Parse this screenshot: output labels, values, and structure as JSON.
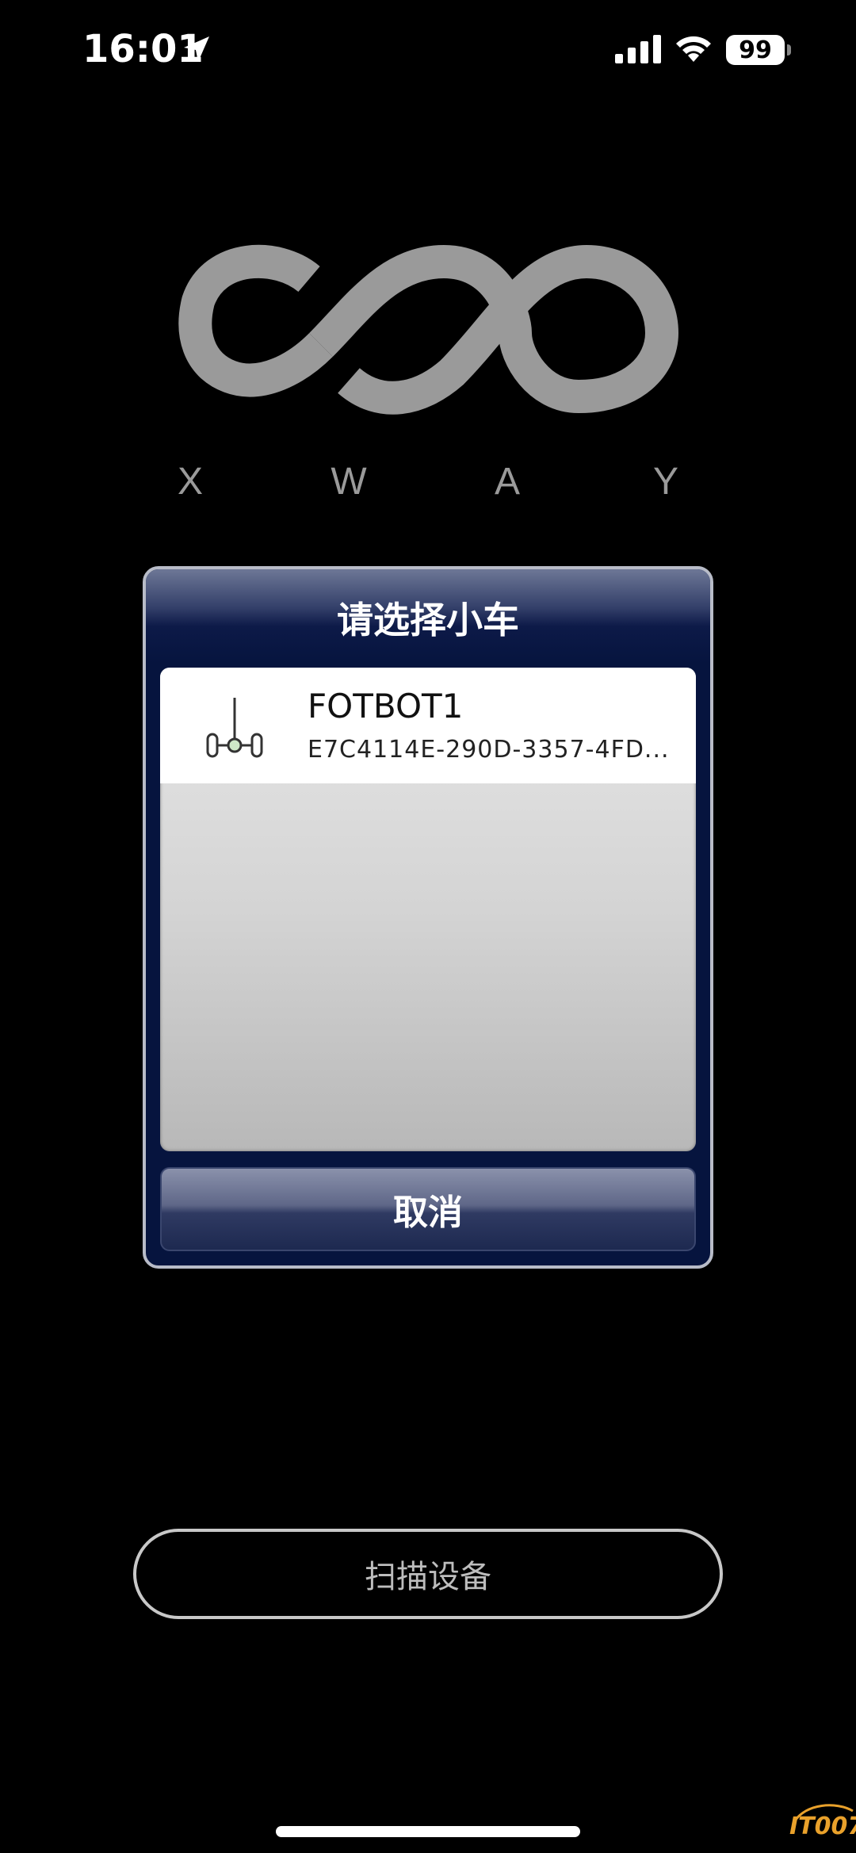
{
  "status_bar": {
    "time": "16:01",
    "battery": "99",
    "icons": [
      "location-arrow-icon",
      "cellular-signal-icon",
      "wifi-icon",
      "battery-icon"
    ]
  },
  "logo": {
    "letters": [
      "X",
      "W",
      "A",
      "Y"
    ]
  },
  "dialog": {
    "title": "请选择小车",
    "devices": [
      {
        "name": "FOTBOT1",
        "uuid": "E7C4114E-290D-3357-4FD...",
        "icon": "robot-car-icon"
      }
    ],
    "cancel_label": "取消"
  },
  "scan_button": {
    "label": "扫描设备"
  },
  "watermark": {
    "text": "IT007"
  },
  "colors": {
    "background": "#000000",
    "dialog_navy": "#06143e",
    "logo_gray": "#9a9a9a",
    "watermark_orange": "#e9a12b"
  }
}
